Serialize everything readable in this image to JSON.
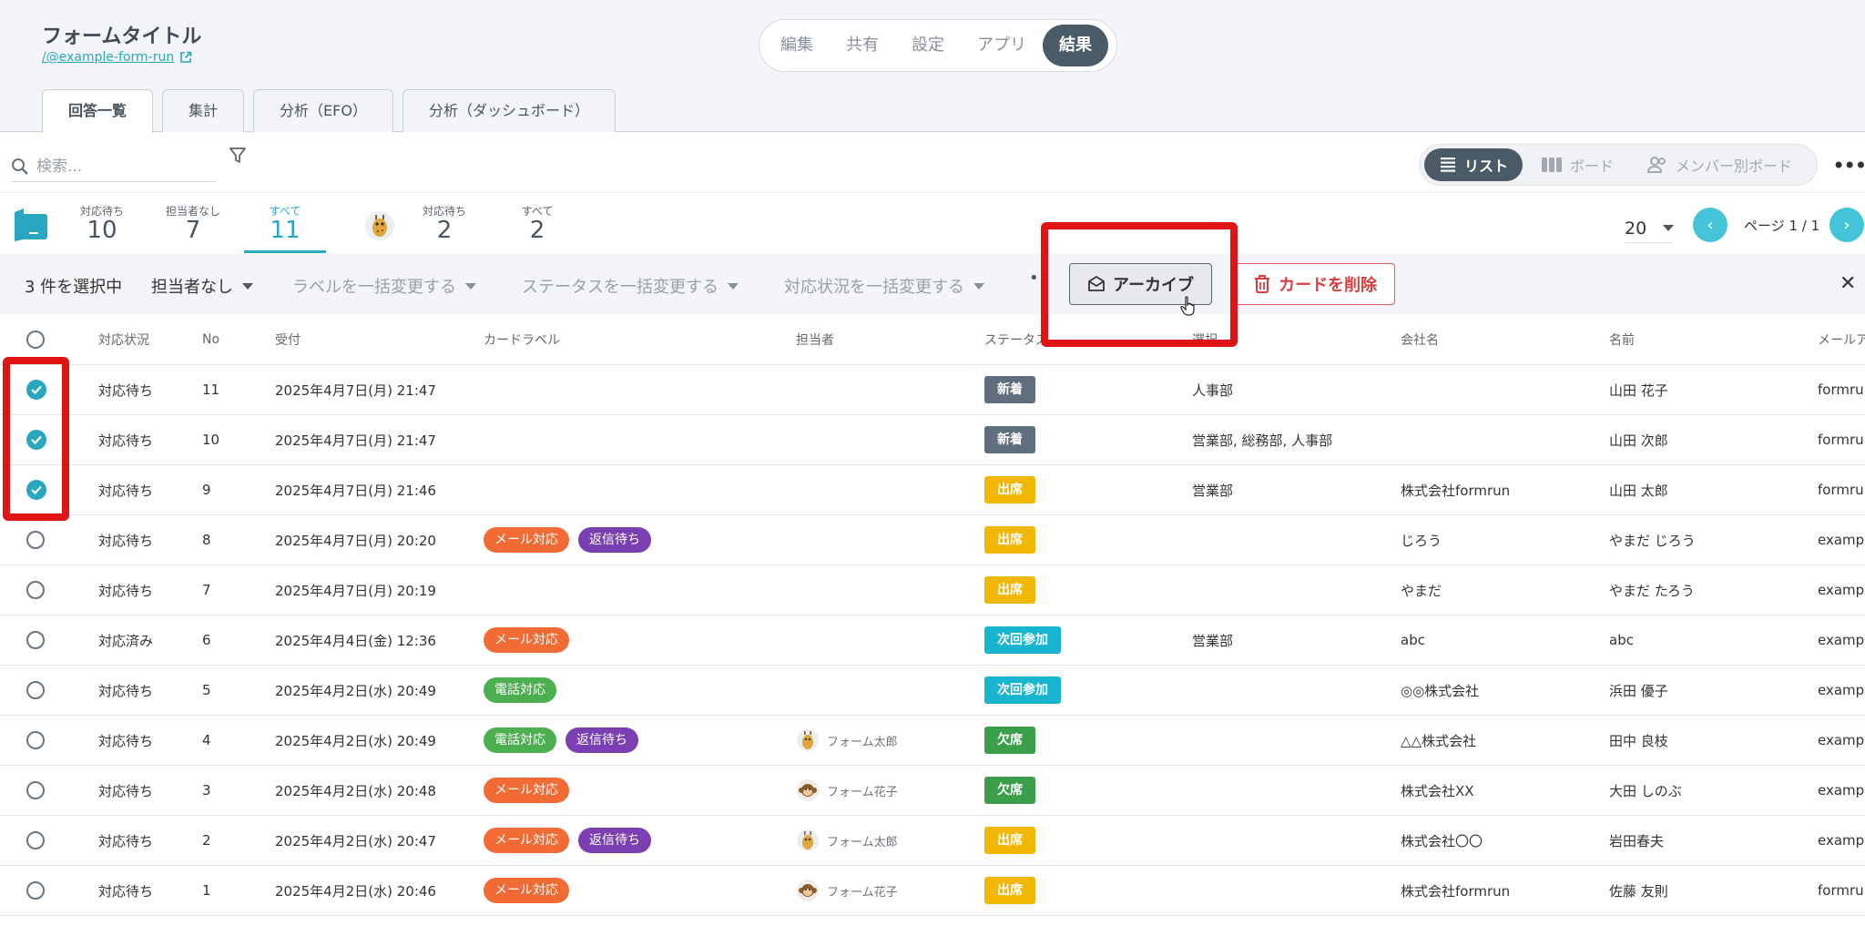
{
  "header": {
    "form_title": "フォームタイトル",
    "form_link": "/@example-form-run",
    "main_tabs": [
      "編集",
      "共有",
      "設定",
      "アプリ",
      "結果"
    ],
    "active_main_tab": "結果",
    "sub_tabs": [
      "回答一覧",
      "集計",
      "分析（EFO）",
      "分析（ダッシュボード）"
    ],
    "active_sub_tab": "回答一覧"
  },
  "toolbar": {
    "search_placeholder": "検索...",
    "views": [
      "リスト",
      "ボード",
      "メンバー別ボード"
    ],
    "active_view": "リスト"
  },
  "stats": [
    {
      "label": "対応待ち",
      "count": "10"
    },
    {
      "label": "担当者なし",
      "count": "7"
    },
    {
      "label": "すべて",
      "count": "11",
      "active": true
    },
    {
      "label": "対応待ち",
      "count": "2"
    },
    {
      "label": "すべて",
      "count": "2"
    }
  ],
  "pagination": {
    "per_page": "20",
    "page_info": "ページ 1 / 1"
  },
  "bulk": {
    "selected": "3 件を選択中",
    "assignee": "担当者なし",
    "label_change": "ラベルを一括変更する",
    "status_change": "ステータスを一括変更する",
    "progress_change": "対応状況を一括変更する",
    "archive": "アーカイブ",
    "delete": "カードを削除"
  },
  "columns": [
    "対応状況",
    "No",
    "受付",
    "カードラベル",
    "担当者",
    "ステータス",
    "選択",
    "会社名",
    "名前",
    "メールア"
  ],
  "colors": {
    "accent": "#2aa7c0",
    "tag_mail": "#f26a34",
    "tag_wait": "#7b3fb3",
    "tag_phone": "#4caf50",
    "status_new": "#5f6f7d",
    "status_attend": "#f2b705",
    "status_next": "#17b5cf",
    "status_absent": "#3a9f48",
    "highlight": "#e01414"
  },
  "rows": [
    {
      "checked": true,
      "progress": "対応待ち",
      "no": "11",
      "received": "2025年4月7日(月) 21:47",
      "labels": [],
      "assignee": "",
      "status": "新着",
      "choice": "人事部",
      "company": "",
      "name": "山田 花子",
      "email": "formrun"
    },
    {
      "checked": true,
      "progress": "対応待ち",
      "no": "10",
      "received": "2025年4月7日(月) 21:47",
      "labels": [],
      "assignee": "",
      "status": "新着",
      "choice": "営業部, 総務部, 人事部",
      "company": "",
      "name": "山田 次郎",
      "email": "formrun"
    },
    {
      "checked": true,
      "progress": "対応待ち",
      "no": "9",
      "received": "2025年4月7日(月) 21:46",
      "labels": [],
      "assignee": "",
      "status": "出席",
      "choice": "営業部",
      "company": "株式会社formrun",
      "name": "山田 太郎",
      "email": "formrun"
    },
    {
      "checked": false,
      "progress": "対応待ち",
      "no": "8",
      "received": "2025年4月7日(月) 20:20",
      "labels": [
        "メール対応",
        "返信待ち"
      ],
      "assignee": "",
      "status": "出席",
      "choice": "",
      "company": "じろう",
      "name": "やまだ じろう",
      "email": "example"
    },
    {
      "checked": false,
      "progress": "対応待ち",
      "no": "7",
      "received": "2025年4月7日(月) 20:19",
      "labels": [],
      "assignee": "",
      "status": "出席",
      "choice": "",
      "company": "やまだ",
      "name": "やまだ たろう",
      "email": "example"
    },
    {
      "checked": false,
      "progress": "対応済み",
      "no": "6",
      "received": "2025年4月4日(金) 12:36",
      "labels": [
        "メール対応"
      ],
      "assignee": "",
      "status": "次回参加",
      "choice": "営業部",
      "company": "abc",
      "name": "abc",
      "email": "example"
    },
    {
      "checked": false,
      "progress": "対応待ち",
      "no": "5",
      "received": "2025年4月2日(水) 20:49",
      "labels": [
        "電話対応"
      ],
      "assignee": "",
      "status": "次回参加",
      "choice": "",
      "company": "◎◎株式会社",
      "name": "浜田 優子",
      "email": "example"
    },
    {
      "checked": false,
      "progress": "対応待ち",
      "no": "4",
      "received": "2025年4月2日(水) 20:49",
      "labels": [
        "電話対応",
        "返信待ち"
      ],
      "assignee": "フォーム太郎",
      "assignee_avatar": "giraffe",
      "status": "欠席",
      "choice": "",
      "company": "△△株式会社",
      "name": "田中 良枝",
      "email": "example"
    },
    {
      "checked": false,
      "progress": "対応待ち",
      "no": "3",
      "received": "2025年4月2日(水) 20:48",
      "labels": [
        "メール対応"
      ],
      "assignee": "フォーム花子",
      "assignee_avatar": "monkey",
      "status": "欠席",
      "choice": "",
      "company": "株式会社XX",
      "name": "大田 しのぶ",
      "email": "example"
    },
    {
      "checked": false,
      "progress": "対応待ち",
      "no": "2",
      "received": "2025年4月2日(水) 20:47",
      "labels": [
        "メール対応",
        "返信待ち"
      ],
      "assignee": "フォーム太郎",
      "assignee_avatar": "giraffe",
      "status": "出席",
      "choice": "",
      "company": "株式会社〇〇",
      "name": "岩田春夫",
      "email": "example"
    },
    {
      "checked": false,
      "progress": "対応待ち",
      "no": "1",
      "received": "2025年4月2日(水) 20:46",
      "labels": [
        "メール対応"
      ],
      "assignee": "フォーム花子",
      "assignee_avatar": "monkey",
      "status": "出席",
      "choice": "",
      "company": "株式会社formrun",
      "name": "佐藤 友則",
      "email": "formrun"
    }
  ]
}
